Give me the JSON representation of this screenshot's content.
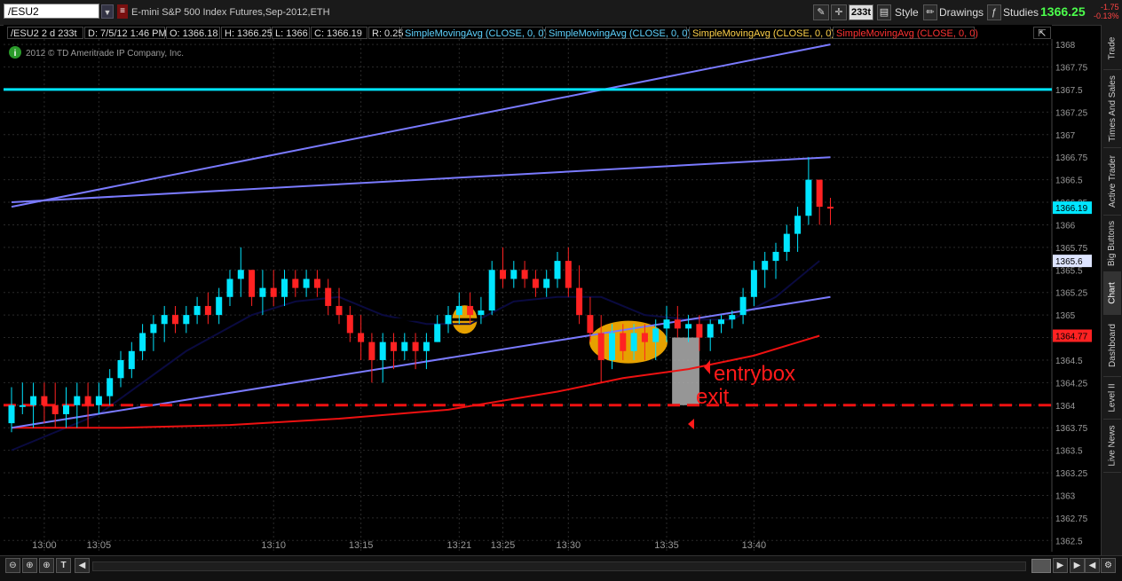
{
  "toolbar": {
    "symbol": "/ESU2",
    "description": "E-mini S&P 500 Index Futures,Sep-2012,ETH",
    "aggregation": "233t",
    "style_label": "Style",
    "drawings_label": "Drawings",
    "studies_label": "Studies",
    "last_price": "1366.25",
    "change": "-1.75",
    "change_pct": "-0.13%"
  },
  "infobar": {
    "symbol": "/ESU2 2 d 233t",
    "date": "D: 7/5/12 1:46 PM",
    "open": "O: 1366.18",
    "high": "H: 1366.25",
    "low": "L: 1366",
    "close": "C: 1366.19",
    "range": "R: 0.25",
    "studies": [
      {
        "label": "SimpleMovingAvg (CLOSE, 0, 0)",
        "color": "#5fd3ff"
      },
      {
        "label": "SimpleMovingAvg (CLOSE, 0, 0)",
        "color": "#5fd3ff"
      },
      {
        "label": "SimpleMovingAvg (CLOSE, 0, 0)",
        "color": "#ffd24a"
      },
      {
        "label": "SimpleMovingAvg (CLOSE, 0, 0)",
        "color": "#ff3333"
      }
    ]
  },
  "copyright": "2012 © TD Ameritrade IP Company, Inc.",
  "sidebar": [
    "Trade",
    "Times And Sales",
    "Active Trader",
    "Big Buttons",
    "Chart",
    "Dashboard",
    "Level II",
    "Live News"
  ],
  "annotations": {
    "entrybox": "entrybox",
    "exit": "exit"
  },
  "price_tags": [
    {
      "value": "1366.19",
      "bg": "#00e5ff",
      "fg": "#000"
    },
    {
      "value": "1365.6",
      "bg": "#dde4ff",
      "fg": "#000"
    },
    {
      "value": "1364.77",
      "bg": "#ff2222",
      "fg": "#000"
    }
  ],
  "chart_data": {
    "type": "candlestick",
    "title": "",
    "ylim": [
      1362.375,
      1368.06
    ],
    "y_ticks": [
      "1368",
      "1367.75",
      "1367.5",
      "1367.25",
      "1367",
      "1366.75",
      "1366.5",
      "1366.25",
      "1366",
      "1365.75",
      "1365.5",
      "1365.25",
      "1365",
      "1364.75",
      "1364.5",
      "1364.25",
      "1364",
      "1363.75",
      "1363.5",
      "1363.25",
      "1363",
      "1362.75",
      "1362.5"
    ],
    "x_ticks": [
      {
        "label": "13:00",
        "bar": 3
      },
      {
        "label": "13:05",
        "bar": 8
      },
      {
        "label": "13:10",
        "bar": 24
      },
      {
        "label": "13:15",
        "bar": 32
      },
      {
        "label": "13:21",
        "bar": 41
      },
      {
        "label": "13:25",
        "bar": 45
      },
      {
        "label": "13:30",
        "bar": 51
      },
      {
        "label": "13:35",
        "bar": 60
      },
      {
        "label": "13:40",
        "bar": 68
      }
    ],
    "candles": [
      [
        1363.8,
        1364.2,
        1363.7,
        1364.0
      ],
      [
        1364.0,
        1364.25,
        1363.9,
        1364.0
      ],
      [
        1364.0,
        1364.25,
        1363.75,
        1364.1
      ],
      [
        1364.1,
        1364.25,
        1363.8,
        1364.0
      ],
      [
        1364.0,
        1364.25,
        1363.75,
        1363.9
      ],
      [
        1363.9,
        1364.2,
        1363.75,
        1364.0
      ],
      [
        1364.0,
        1364.25,
        1363.75,
        1364.1
      ],
      [
        1364.1,
        1364.25,
        1363.75,
        1364.0
      ],
      [
        1364.0,
        1364.25,
        1363.9,
        1364.1
      ],
      [
        1364.1,
        1364.4,
        1364.0,
        1364.3
      ],
      [
        1364.3,
        1364.6,
        1364.2,
        1364.5
      ],
      [
        1364.4,
        1364.7,
        1364.3,
        1364.6
      ],
      [
        1364.6,
        1364.9,
        1364.5,
        1364.8
      ],
      [
        1364.8,
        1365.0,
        1364.6,
        1364.9
      ],
      [
        1364.9,
        1365.1,
        1364.7,
        1365.0
      ],
      [
        1365.0,
        1365.1,
        1364.8,
        1364.9
      ],
      [
        1364.9,
        1365.1,
        1364.8,
        1365.0
      ],
      [
        1365.0,
        1365.2,
        1364.9,
        1365.1
      ],
      [
        1365.1,
        1365.25,
        1364.9,
        1365.0
      ],
      [
        1365.0,
        1365.3,
        1364.9,
        1365.2
      ],
      [
        1365.2,
        1365.5,
        1365.1,
        1365.4
      ],
      [
        1365.4,
        1365.75,
        1365.2,
        1365.5
      ],
      [
        1365.5,
        1365.5,
        1365.1,
        1365.2
      ],
      [
        1365.2,
        1365.5,
        1365.0,
        1365.3
      ],
      [
        1365.3,
        1365.5,
        1365.1,
        1365.2
      ],
      [
        1365.2,
        1365.5,
        1365.1,
        1365.4
      ],
      [
        1365.4,
        1365.5,
        1365.2,
        1365.3
      ],
      [
        1365.3,
        1365.5,
        1365.2,
        1365.4
      ],
      [
        1365.4,
        1365.5,
        1365.2,
        1365.3
      ],
      [
        1365.3,
        1365.4,
        1365.0,
        1365.1
      ],
      [
        1365.1,
        1365.3,
        1364.9,
        1365.0
      ],
      [
        1365.0,
        1365.1,
        1364.7,
        1364.8
      ],
      [
        1364.8,
        1365.0,
        1364.5,
        1364.7
      ],
      [
        1364.7,
        1364.8,
        1364.25,
        1364.5
      ],
      [
        1364.5,
        1364.8,
        1364.25,
        1364.7
      ],
      [
        1364.7,
        1364.8,
        1364.4,
        1364.6
      ],
      [
        1364.6,
        1364.8,
        1364.5,
        1364.7
      ],
      [
        1364.7,
        1364.8,
        1364.4,
        1364.6
      ],
      [
        1364.6,
        1364.8,
        1364.4,
        1364.7
      ],
      [
        1364.7,
        1365.0,
        1364.7,
        1364.9
      ],
      [
        1364.9,
        1365.1,
        1364.8,
        1365.0
      ],
      [
        1365.0,
        1365.25,
        1364.9,
        1365.1
      ],
      [
        1365.1,
        1365.25,
        1364.9,
        1365.0
      ],
      [
        1365.0,
        1365.2,
        1364.9,
        1365.05
      ],
      [
        1365.05,
        1365.6,
        1365.0,
        1365.5
      ],
      [
        1365.5,
        1365.75,
        1365.3,
        1365.4
      ],
      [
        1365.4,
        1365.6,
        1365.3,
        1365.5
      ],
      [
        1365.5,
        1365.6,
        1365.3,
        1365.4
      ],
      [
        1365.4,
        1365.5,
        1365.2,
        1365.3
      ],
      [
        1365.3,
        1365.5,
        1365.2,
        1365.4
      ],
      [
        1365.4,
        1365.7,
        1365.3,
        1365.6
      ],
      [
        1365.6,
        1365.75,
        1365.2,
        1365.3
      ],
      [
        1365.3,
        1365.55,
        1364.9,
        1365.0
      ],
      [
        1365.0,
        1365.2,
        1364.7,
        1364.8
      ],
      [
        1364.8,
        1365.0,
        1364.25,
        1364.5
      ],
      [
        1364.5,
        1364.9,
        1364.4,
        1364.8
      ],
      [
        1364.8,
        1364.9,
        1364.5,
        1364.6
      ],
      [
        1364.6,
        1364.9,
        1364.5,
        1364.8
      ],
      [
        1364.8,
        1364.9,
        1364.5,
        1364.7
      ],
      [
        1364.7,
        1364.95,
        1364.5,
        1364.85
      ],
      [
        1364.85,
        1365.1,
        1364.7,
        1364.95
      ],
      [
        1364.95,
        1365.1,
        1364.75,
        1364.85
      ],
      [
        1364.85,
        1365.0,
        1364.7,
        1364.9
      ],
      [
        1364.9,
        1365.0,
        1364.6,
        1364.75
      ],
      [
        1364.75,
        1364.95,
        1364.6,
        1364.9
      ],
      [
        1364.9,
        1365.0,
        1364.8,
        1364.95
      ],
      [
        1364.95,
        1365.05,
        1364.85,
        1365.0
      ],
      [
        1365.0,
        1365.3,
        1364.9,
        1365.2
      ],
      [
        1365.2,
        1365.6,
        1365.1,
        1365.5
      ],
      [
        1365.5,
        1365.7,
        1365.3,
        1365.6
      ],
      [
        1365.6,
        1365.8,
        1365.4,
        1365.7
      ],
      [
        1365.7,
        1366.0,
        1365.6,
        1365.9
      ],
      [
        1365.9,
        1366.2,
        1365.7,
        1366.1
      ],
      [
        1366.1,
        1366.75,
        1366.0,
        1366.5
      ],
      [
        1366.5,
        1366.5,
        1366.0,
        1366.2
      ],
      [
        1366.2,
        1366.3,
        1366.0,
        1366.19
      ]
    ],
    "series": [
      {
        "type": "line",
        "color": "#0a0a40",
        "y_at_bar": [
          [
            0,
            1363.5
          ],
          [
            8,
            1363.9
          ],
          [
            16,
            1364.6
          ],
          [
            22,
            1365.0
          ],
          [
            26,
            1365.15
          ],
          [
            30,
            1365.2
          ],
          [
            34,
            1365.0
          ],
          [
            38,
            1364.9
          ],
          [
            42,
            1364.9
          ],
          [
            46,
            1365.15
          ],
          [
            50,
            1365.2
          ],
          [
            54,
            1365.2
          ],
          [
            58,
            1365.0
          ],
          [
            62,
            1364.95
          ],
          [
            66,
            1364.95
          ],
          [
            70,
            1365.2
          ],
          [
            74,
            1365.6
          ]
        ]
      },
      {
        "type": "line",
        "color": "#ee1111",
        "y_at_bar": [
          [
            0,
            1363.75
          ],
          [
            10,
            1363.75
          ],
          [
            20,
            1363.78
          ],
          [
            30,
            1363.85
          ],
          [
            40,
            1363.95
          ],
          [
            50,
            1364.15
          ],
          [
            56,
            1364.3
          ],
          [
            62,
            1364.4
          ],
          [
            68,
            1364.55
          ],
          [
            74,
            1364.77
          ]
        ]
      },
      {
        "type": "line",
        "color": "#7a7aff",
        "y_at_bar": [
          [
            0,
            1363.75
          ],
          [
            75,
            1365.2
          ]
        ]
      },
      {
        "type": "line",
        "color": "#7a7aff",
        "y_at_bar": [
          [
            0,
            1366.25
          ],
          [
            75,
            1366.75
          ]
        ]
      },
      {
        "type": "line",
        "color": "#7a7aff",
        "y_at_bar": [
          [
            0,
            1366.2
          ],
          [
            75,
            1368.0
          ]
        ]
      },
      {
        "type": "hline",
        "color": "#00e5ff",
        "value": 1367.5
      },
      {
        "type": "hline",
        "color": "#ee1111",
        "value": 1364.0,
        "dashed": true
      },
      {
        "type": "segment",
        "color": "#000000",
        "x": [
          24,
          40
        ],
        "value": 1364.95
      }
    ]
  }
}
